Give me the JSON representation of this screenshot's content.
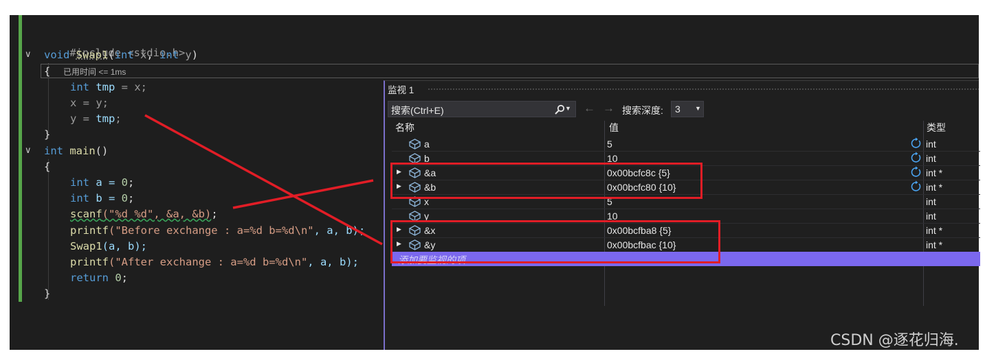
{
  "editor": {
    "lines": {
      "l1": "#include <stdio.h>",
      "l2_kw": "void",
      "l2_fn": "Swap1",
      "l2_p1kw": "int",
      "l2_p1": "x",
      "l2_p2kw": "int",
      "l2_p2": "y",
      "l3_brace": "{",
      "hint": "已用时间 <= 1ms",
      "l4_kw": "int",
      "l4_var": "tmp",
      "l4_rest": " = x;",
      "l5": "x = y;",
      "l6_a": "y = ",
      "l6_var": "tmp",
      "l6_b": ";",
      "l7": "}",
      "l8_kw": "int",
      "l8_fn": "main",
      "l8_rest": "()",
      "l9": "{",
      "l10_kw": "int",
      "l10_rest": " a = ",
      "l10_num": "0",
      "l10_end": ";",
      "l11_kw": "int",
      "l11_rest": " b = ",
      "l11_num": "0",
      "l11_end": ";",
      "l12_fn": "scanf",
      "l12_str": "(\"%d %d\", &a, &b)",
      "l12_end": ";",
      "l13_fn": "printf",
      "l13_str": "(\"Before exchange : a=%d b=%d\\n\"",
      "l13_end": ", a, b);",
      "l14_fn": "Swap1",
      "l14_rest": "(a, b);",
      "l15_fn": "printf",
      "l15_str": "(\"After exchange : a=%d b=%d\\n\"",
      "l15_end": ", a, b);",
      "l16_kw": "return",
      "l16_num": " 0",
      "l16_end": ";",
      "l17": "}"
    }
  },
  "watch": {
    "title": "监视 1",
    "search_placeholder": "搜索(Ctrl+E)",
    "depth_label": "搜索深度:",
    "depth_value": "3",
    "columns": {
      "name": "名称",
      "value": "值",
      "type": "类型"
    },
    "rows": [
      {
        "name": "a",
        "value": "5",
        "type": "int",
        "expandable": false,
        "refresh": true
      },
      {
        "name": "b",
        "value": "10",
        "type": "int",
        "expandable": false,
        "refresh": true
      },
      {
        "name": "&a",
        "value": "0x00bcfc8c {5}",
        "type": "int *",
        "expandable": true,
        "refresh": true
      },
      {
        "name": "&b",
        "value": "0x00bcfc80 {10}",
        "type": "int *",
        "expandable": true,
        "refresh": true
      },
      {
        "name": "x",
        "value": "5",
        "type": "int",
        "expandable": false,
        "refresh": false
      },
      {
        "name": "y",
        "value": "10",
        "type": "int",
        "expandable": false,
        "refresh": false
      },
      {
        "name": "&x",
        "value": "0x00bcfba8 {5}",
        "type": "int *",
        "expandable": true,
        "refresh": false
      },
      {
        "name": "&y",
        "value": "0x00bcfbac {10}",
        "type": "int *",
        "expandable": true,
        "refresh": false
      }
    ],
    "add_item": "添加要监视的项"
  },
  "watermark": "CSDN @逐花归海.",
  "colors": {
    "annotation_red": "#e11d26",
    "accent_purple": "#7b68ee",
    "gutter_green": "#57a64a"
  }
}
